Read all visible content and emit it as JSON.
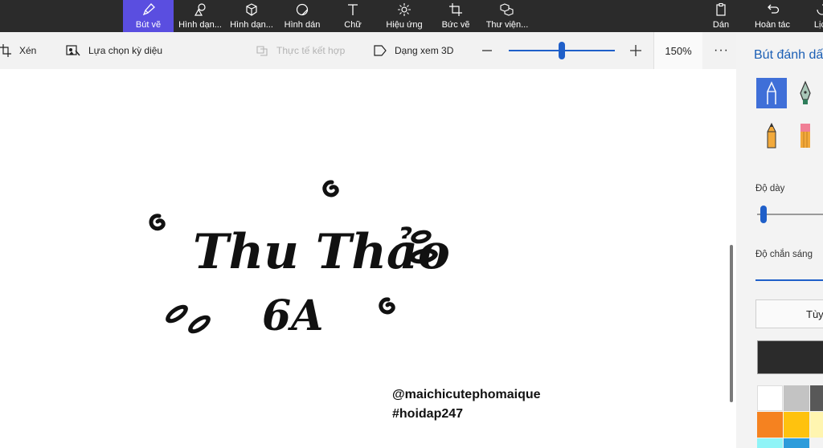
{
  "toolbar": {
    "brushes": "Bút vẽ",
    "shapes2d": "Hình dạn...",
    "shapes3d": "Hình dạn...",
    "stickers": "Hình dán",
    "text": "Chữ",
    "effects": "Hiệu ứng",
    "canvas": "Bức vẽ",
    "library": "Thư viện...",
    "paste": "Dán",
    "undo": "Hoàn tác",
    "history": "Lịch"
  },
  "subbar": {
    "crop": "Xén",
    "magic_select": "Lựa chọn kỳ diệu",
    "mixed_reality": "Thực tế kết hợp",
    "view_3d": "Dạng xem 3D",
    "zoom": "150%",
    "zoom_level": 0.5
  },
  "canvas": {
    "drawing_line1": "Thu Thảo",
    "drawing_line2": "6A",
    "watermark_handle": "@maichicutephomaique",
    "watermark_tag": "#hoidap247"
  },
  "panel": {
    "title": "Bút đánh dấu",
    "thickness_label": "Độ dày",
    "opacity_label": "Độ chắn sáng",
    "custom_button": "Tùy",
    "thickness_level": 0.05
  },
  "colors": {
    "selected": "#2b2b2b",
    "row1": [
      "#ffffff",
      "#c3c3c3",
      "#585858"
    ],
    "row2": [
      "#f58220",
      "#ffc20e",
      "#fff5b0"
    ],
    "row3": [
      "#8ff4f7",
      "#2d9cdb"
    ],
    "accent": "#3f6fd8"
  }
}
